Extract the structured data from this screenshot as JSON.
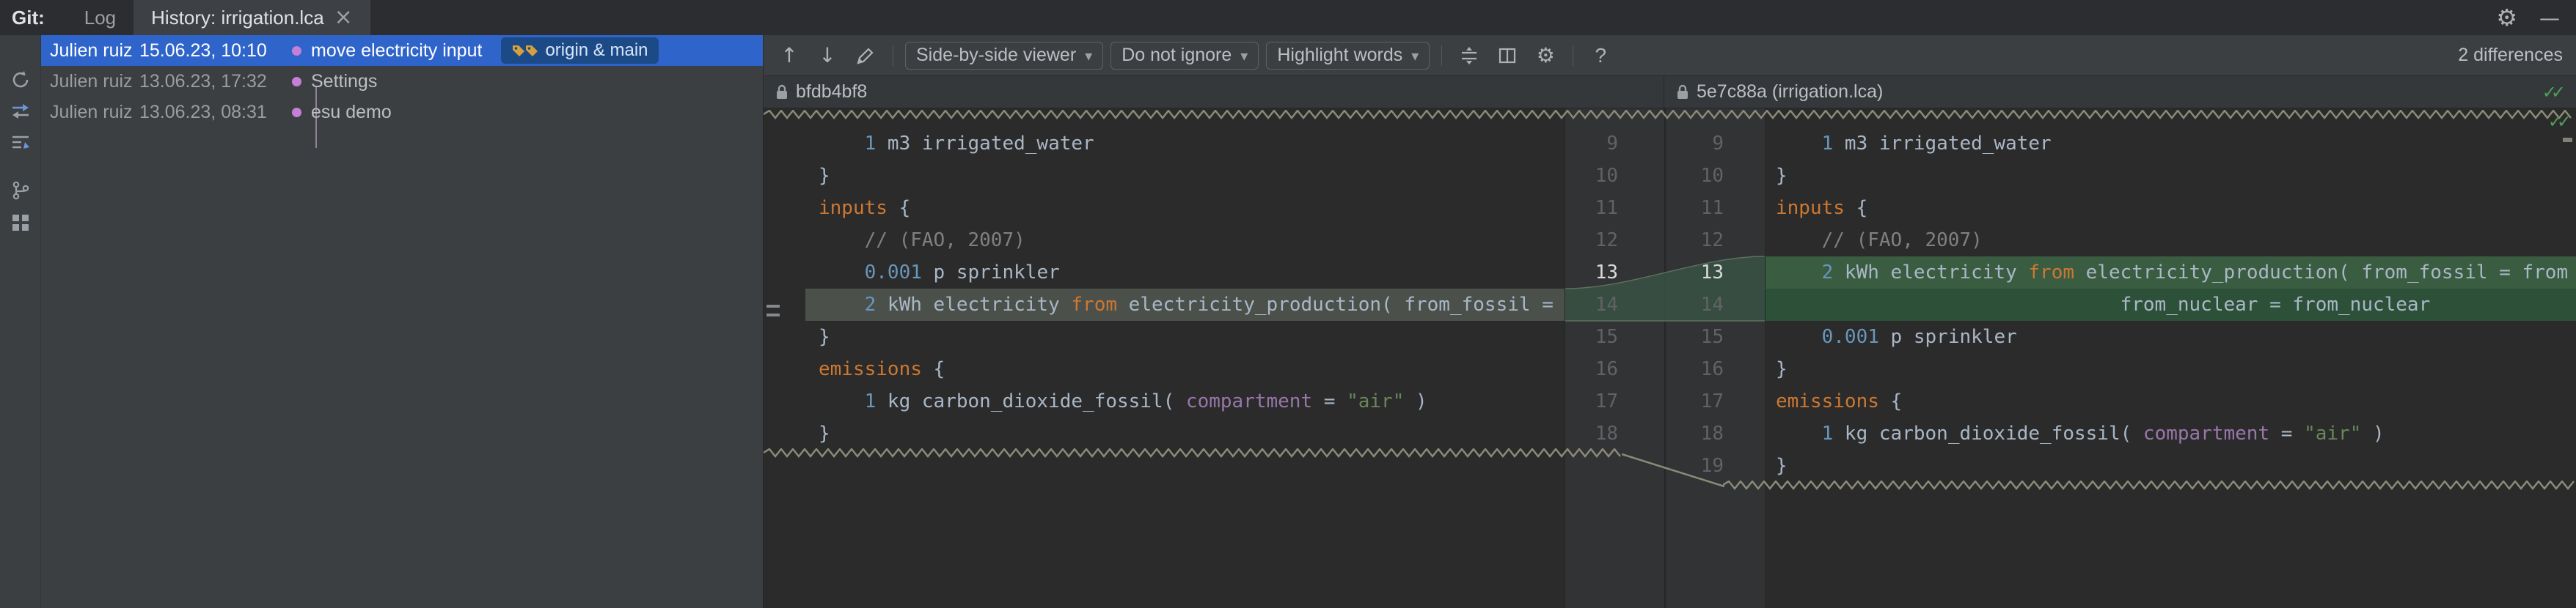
{
  "colors": {
    "topbar_bg": "#2b2d30",
    "panel_bg": "#3c3f41",
    "editor_bg": "#2b2b2b",
    "gutter_bg": "#313335",
    "selection_blue": "#2f65ca",
    "ref_pill_bg": "#1c4a87",
    "tag_yellow": "#d6a03c",
    "commit_dot_purple": "#c57fd6",
    "diff_insert_green": "#2d5038",
    "diff_insert_current_green": "#3a5c41",
    "diff_moved_grey": "#4b504b",
    "check_green": "#4f9e58",
    "syntax": {
      "default": "#a9b7c6",
      "keyword": "#cc7832",
      "number": "#6897bb",
      "comment": "#808080",
      "string": "#6a8759",
      "field": "#9876aa",
      "line_number": "#606366"
    }
  },
  "icons": {
    "gear": "⚙",
    "minimize": "—",
    "close": "×",
    "caret_down": "▾",
    "arrow_up": "↑",
    "arrow_down": "↓",
    "help": "?",
    "check": "✓✓"
  },
  "top_bar": {
    "git_label": "Git:",
    "tabs": [
      {
        "label": "Log",
        "active": false
      },
      {
        "label": "History: irrigation.lca",
        "active": true,
        "closable": true
      }
    ]
  },
  "history": {
    "rows": [
      {
        "author": "Julien ruiz",
        "date": "15.06.23, 10:10",
        "message": "move electricity input",
        "refs": "origin & main",
        "selected": true
      },
      {
        "author": "Julien ruiz",
        "date": "13.06.23, 17:32",
        "message": "Settings",
        "refs": null,
        "selected": false
      },
      {
        "author": "Julien ruiz",
        "date": "13.06.23, 08:31",
        "message": "esu demo",
        "refs": null,
        "selected": false
      }
    ]
  },
  "diff_toolbar": {
    "viewer_dropdown": "Side-by-side viewer",
    "ignore_dropdown": "Do not ignore",
    "highlight_dropdown": "Highlight words",
    "differences_label": "2 differences"
  },
  "pane_headers": {
    "left_title": "bfdb4bf8",
    "right_title": "5e7c88a (irrigation.lca)"
  },
  "diff": {
    "rows": [
      {
        "ln_l": "9",
        "ln_r": "9",
        "num_hl": false,
        "l_hl": null,
        "r_hl": null,
        "l": [
          [
            "    ",
            "d"
          ],
          [
            "1",
            "n"
          ],
          [
            " m3 irrigated_water",
            "d"
          ]
        ],
        "r": [
          [
            "    ",
            "d"
          ],
          [
            "1",
            "n"
          ],
          [
            " m3 irrigated_water",
            "d"
          ]
        ]
      },
      {
        "ln_l": "10",
        "ln_r": "10",
        "num_hl": false,
        "l_hl": null,
        "r_hl": null,
        "l": [
          [
            "}",
            "d"
          ]
        ],
        "r": [
          [
            "}",
            "d"
          ]
        ]
      },
      {
        "ln_l": "11",
        "ln_r": "11",
        "num_hl": false,
        "l_hl": null,
        "r_hl": null,
        "l": [
          [
            "inputs",
            "k"
          ],
          [
            " {",
            "d"
          ]
        ],
        "r": [
          [
            "inputs",
            "k"
          ],
          [
            " {",
            "d"
          ]
        ]
      },
      {
        "ln_l": "12",
        "ln_r": "12",
        "num_hl": false,
        "l_hl": null,
        "r_hl": null,
        "l": [
          [
            "    ",
            "d"
          ],
          [
            "// (FAO, 2007)",
            "c"
          ]
        ],
        "r": [
          [
            "    ",
            "d"
          ],
          [
            "// (FAO, 2007)",
            "c"
          ]
        ]
      },
      {
        "ln_l": "13",
        "ln_r": "13",
        "num_hl": true,
        "l_hl": null,
        "r_hl": "cur",
        "l": [
          [
            "    ",
            "d"
          ],
          [
            "0.001",
            "n"
          ],
          [
            " p sprinkler",
            "d"
          ]
        ],
        "r": [
          [
            "    ",
            "d"
          ],
          [
            "2",
            "n"
          ],
          [
            " kWh electricity ",
            "d"
          ],
          [
            "from",
            "k"
          ],
          [
            " electricity_production( from_fossil = from",
            "d"
          ]
        ]
      },
      {
        "ln_l": "14",
        "ln_r": "14",
        "num_hl": false,
        "l_hl": "moved",
        "r_hl": "ins",
        "l": [
          [
            "    ",
            "d"
          ],
          [
            "2",
            "n"
          ],
          [
            " kWh electricity ",
            "d"
          ],
          [
            "from",
            "k"
          ],
          [
            " electricity_production( from_fossil = fr",
            "d"
          ]
        ],
        "r": [
          [
            "                              from_nuclear = from_nuclear",
            "d"
          ]
        ]
      },
      {
        "ln_l": "15",
        "ln_r": "15",
        "num_hl": false,
        "l_hl": null,
        "r_hl": null,
        "l": [
          [
            "}",
            "d"
          ]
        ],
        "r": [
          [
            "    ",
            "d"
          ],
          [
            "0.001",
            "n"
          ],
          [
            " p sprinkler",
            "d"
          ]
        ]
      },
      {
        "ln_l": "16",
        "ln_r": "16",
        "num_hl": false,
        "l_hl": null,
        "r_hl": null,
        "l": [
          [
            "emissions",
            "k"
          ],
          [
            " {",
            "d"
          ]
        ],
        "r": [
          [
            "}",
            "d"
          ]
        ]
      },
      {
        "ln_l": "17",
        "ln_r": "17",
        "num_hl": false,
        "l_hl": null,
        "r_hl": null,
        "l": [
          [
            "    ",
            "d"
          ],
          [
            "1",
            "n"
          ],
          [
            " kg carbon_dioxide_fossil( ",
            "d"
          ],
          [
            "compartment",
            "f"
          ],
          [
            " = ",
            "d"
          ],
          [
            "\"air\"",
            "s"
          ],
          [
            " )",
            "d"
          ]
        ],
        "r": [
          [
            "emissions",
            "k"
          ],
          [
            " {",
            "d"
          ]
        ]
      },
      {
        "ln_l": "18",
        "ln_r": "18",
        "num_hl": false,
        "l_hl": null,
        "r_hl": null,
        "l": [
          [
            "}",
            "d"
          ]
        ],
        "r": [
          [
            "    ",
            "d"
          ],
          [
            "1",
            "n"
          ],
          [
            " kg carbon_dioxide_fossil( ",
            "d"
          ],
          [
            "compartment",
            "f"
          ],
          [
            " = ",
            "d"
          ],
          [
            "\"air\"",
            "s"
          ],
          [
            " )",
            "d"
          ]
        ]
      },
      {
        "ln_l": "",
        "ln_r": "19",
        "num_hl": false,
        "l_hl": null,
        "r_hl": null,
        "l": null,
        "r": [
          [
            "}",
            "d"
          ]
        ]
      }
    ]
  }
}
